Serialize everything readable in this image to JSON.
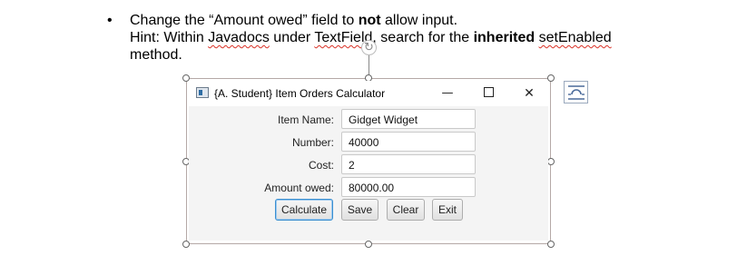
{
  "document": {
    "bullet": "•",
    "line1_prefix": "Change the “Amount owed” field to ",
    "line1_bold": "not",
    "line1_suffix": " allow input.",
    "line2_part1": "Hint: Within ",
    "line2_javadocs": "Javadocs",
    "line2_part2": " under ",
    "line2_textfield": "TextField",
    "line2_part3": ", search for the ",
    "line2_bold": "inherited",
    "line2_part4": " ",
    "line2_setenabled": "setEnabled",
    "line3": "method.",
    "rotate_icon": "rotate-icon",
    "layout_options_icon": "layout-options-icon"
  },
  "window": {
    "title": "{A. Student} Item Orders Calculator",
    "minimize_glyph": "—",
    "close_glyph": "✕",
    "icon": "java-app-icon"
  },
  "form": {
    "fields": [
      {
        "label": "Item Name:",
        "value": "Gidget Widget"
      },
      {
        "label": "Number:",
        "value": "40000"
      },
      {
        "label": "Cost:",
        "value": "2"
      },
      {
        "label": "Amount owed:",
        "value": "80000.00"
      }
    ]
  },
  "buttons": {
    "calculate": "Calculate",
    "save": "Save",
    "clear": "Clear",
    "exit": "Exit"
  },
  "colors": {
    "focus_border": "#3a8fd1",
    "spelling_underline": "#d93025",
    "selection_frame": "#b5a9a6"
  }
}
